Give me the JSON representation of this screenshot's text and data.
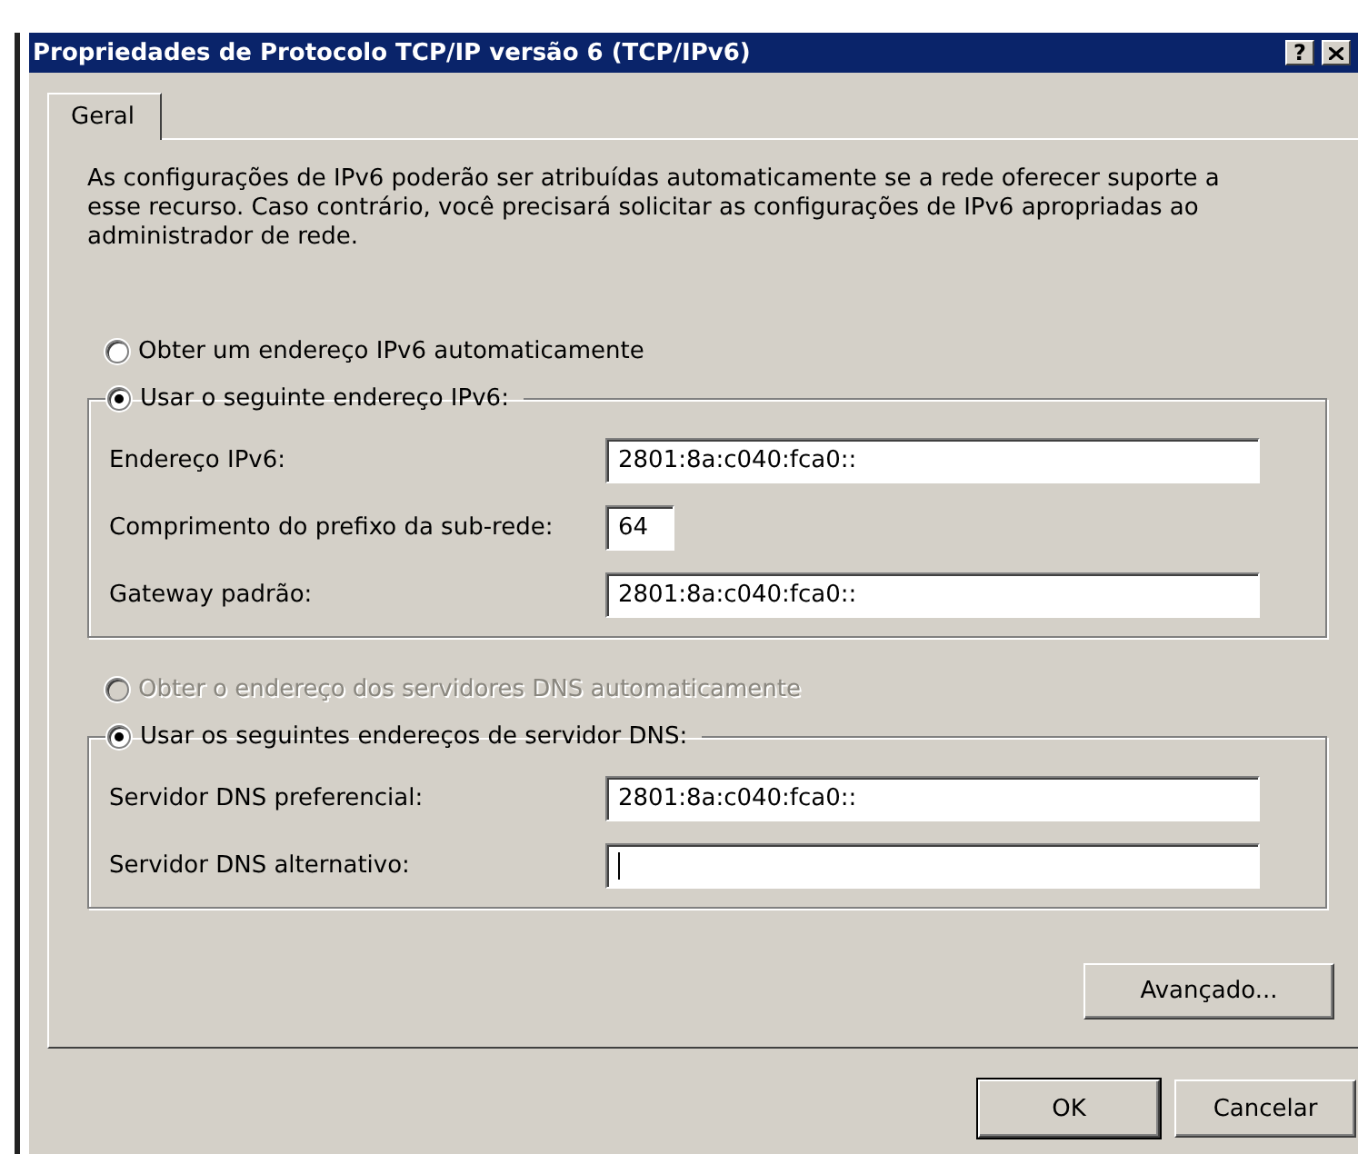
{
  "window": {
    "title": "Propriedades de Protocolo TCP/IP versão 6 (TCP/IPv6)",
    "help_button": "?"
  },
  "tabs": [
    {
      "label": "Geral",
      "selected": true
    }
  ],
  "description": "As configurações de IPv6 poderão ser atribuídas automaticamente se a rede oferecer suporte a esse recurso. Caso contrário, você precisará solicitar as configurações de IPv6 apropriadas ao administrador de rede.",
  "address_section": {
    "options": [
      {
        "label": "Obter um endereço IPv6 automaticamente",
        "selected": false,
        "disabled": false
      },
      {
        "label": "Usar o seguinte endereço IPv6:",
        "selected": true,
        "disabled": false
      }
    ],
    "fields": [
      {
        "label": "Endereço IPv6:",
        "value": "2801:8a:c040:fca0::",
        "kind": "address",
        "focused": false
      },
      {
        "label": "Comprimento do prefixo da sub-rede:",
        "value": "64",
        "kind": "number",
        "focused": false
      },
      {
        "label": "Gateway padrão:",
        "value": "2801:8a:c040:fca0::",
        "kind": "address",
        "focused": false
      }
    ]
  },
  "dns_section": {
    "options": [
      {
        "label": "Obter o endereço dos servidores DNS automaticamente",
        "selected": false,
        "disabled": true
      },
      {
        "label": "Usar os seguintes endereços de servidor DNS:",
        "selected": true,
        "disabled": false
      }
    ],
    "fields": [
      {
        "label": "Servidor DNS preferencial:",
        "value": "2801:8a:c040:fca0::",
        "kind": "address",
        "focused": false
      },
      {
        "label": "Servidor DNS alternativo:",
        "kind": "address",
        "focused": true
      }
    ]
  },
  "advanced_button": "Avançado...",
  "buttons": [
    {
      "label": "OK",
      "default": true
    },
    {
      "label": "Cancelar",
      "default": false
    }
  ]
}
